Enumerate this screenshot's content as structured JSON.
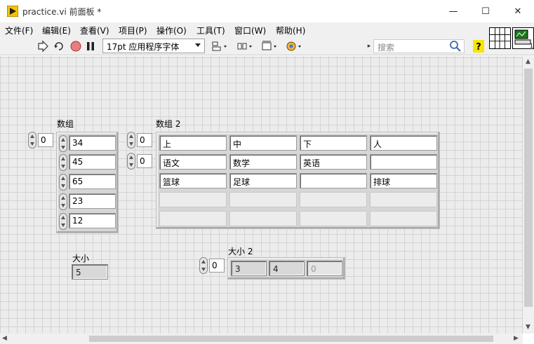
{
  "window": {
    "title": "practice.vi 前面板 *",
    "min_glyph": "—",
    "max_glyph": "☐",
    "close_glyph": "✕"
  },
  "menus": [
    "文件(F)",
    "编辑(E)",
    "查看(V)",
    "项目(P)",
    "操作(O)",
    "工具(T)",
    "窗口(W)",
    "帮助(H)"
  ],
  "toolbar": {
    "font": "17pt 应用程序字体",
    "search_placeholder": "搜索",
    "help_glyph": "?"
  },
  "vi_icon": {
    "number": "1"
  },
  "array1": {
    "label": "数组",
    "index": "0",
    "values": [
      "34",
      "45",
      "65",
      "23",
      "12"
    ]
  },
  "array2": {
    "label": "数组 2",
    "index_row": "0",
    "index_col": "0",
    "rows": [
      [
        "上",
        "中",
        "下",
        "人"
      ],
      [
        "语文",
        "数学",
        "英语",
        ""
      ],
      [
        "篮球",
        "足球",
        "",
        "排球"
      ]
    ]
  },
  "size1": {
    "label": "大小",
    "value": "5"
  },
  "size2": {
    "label": "大小 2",
    "index": "0",
    "values": [
      "3",
      "4",
      "0"
    ]
  },
  "colors": {
    "panel_bg": "#ececec",
    "grid": "#d4d4d4",
    "run_arrow": "#333333",
    "abort": "#cc3333"
  }
}
